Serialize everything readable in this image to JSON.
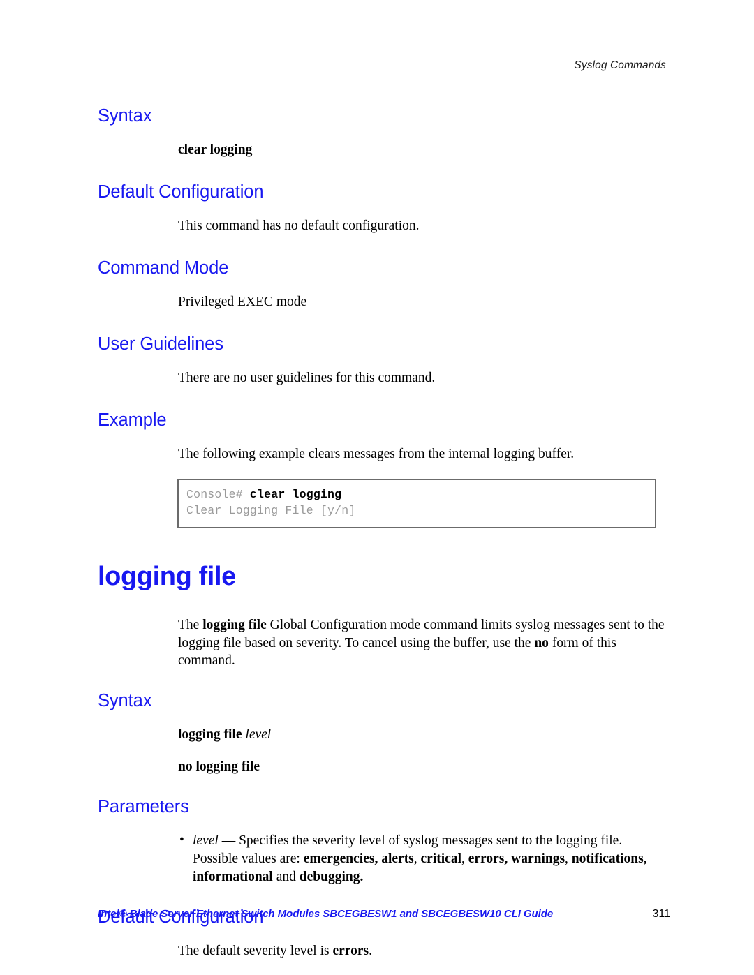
{
  "page": {
    "running_header": "Syslog Commands",
    "footer_text": "Intel® Blade Server Ethernet Switch Modules SBCEGBESW1 and SBCEGBESW10 CLI Guide",
    "footer_page_number": "311",
    "heading_color": "#1818f0",
    "body_color": "#000000",
    "console_text_color": "#9a9a9a",
    "console_border_color": "#6b6b6b"
  },
  "clear_logging": {
    "syntax_heading": "Syntax",
    "syntax_command": "clear logging",
    "default_config_heading": "Default Configuration",
    "default_config_text": "This command has no default configuration.",
    "command_mode_heading": "Command Mode",
    "command_mode_text": "Privileged EXEC mode",
    "user_guidelines_heading": "User Guidelines",
    "user_guidelines_text": "There are no user guidelines for this command.",
    "example_heading": "Example",
    "example_text": "The following example clears messages from the internal logging buffer.",
    "console": {
      "prompt": "Console# ",
      "command": "clear logging",
      "output": "Clear Logging File [y/n]"
    }
  },
  "logging_file": {
    "title": "logging file",
    "description_pre": "The ",
    "description_bold_1": "logging file",
    "description_mid": " Global Configuration mode command limits syslog messages sent to the logging file based on severity. To cancel using the buffer, use the ",
    "description_bold_2": "no",
    "description_post": " form of this command.",
    "syntax_heading": "Syntax",
    "syntax_command_bold": "logging file ",
    "syntax_command_italic": "level",
    "syntax_no_form": "no logging file",
    "parameters_heading": "Parameters",
    "parameter": {
      "bullet": "•",
      "name_italic": "level",
      "dash": " — ",
      "text_1": "Specifies the severity level of syslog messages sent to the logging file. Possible values are: ",
      "values_bold": "emergencies, alerts",
      "sep_1": ", ",
      "values_bold_2": "critical",
      "sep_2": ", ",
      "values_bold_3": "errors, warnings",
      "sep_3": ", ",
      "values_bold_4": "notifications, informational",
      "conjunction": " and ",
      "values_bold_5": "debugging."
    },
    "default_config_heading": "Default Configuration",
    "default_config_text_pre": "The default severity level is ",
    "default_config_text_bold": "errors",
    "default_config_text_post": "."
  }
}
